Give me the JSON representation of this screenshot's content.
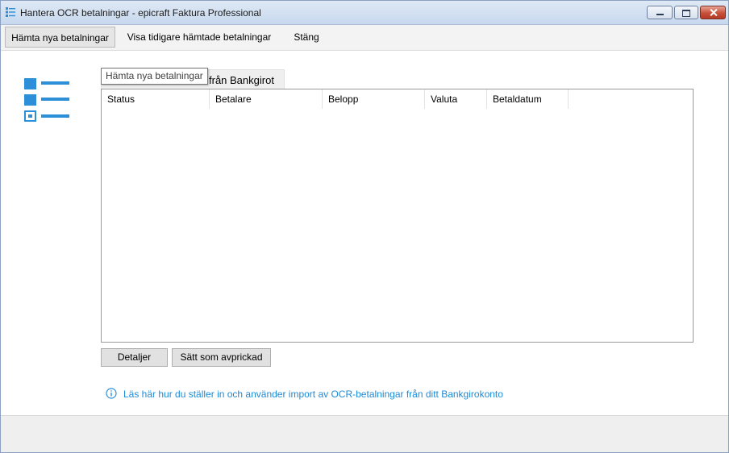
{
  "window": {
    "title": "Hantera OCR betalningar - epicraft Faktura Professional",
    "icon": "list-icon"
  },
  "toolbar": {
    "fetch_new_label": "Hämta nya betalningar",
    "show_previous_label": "Visa tidigare hämtade betalningar",
    "close_label": "Stäng"
  },
  "tooltip": {
    "text": "Hämta nya betalningar"
  },
  "tab": {
    "label": "från Bankgirot"
  },
  "grid": {
    "columns": [
      "Status",
      "Betalare",
      "Belopp",
      "Valuta",
      "Betaldatum"
    ],
    "rows": []
  },
  "actions": {
    "details_label": "Detaljer",
    "mark_label": "Sätt som avprickad"
  },
  "info": {
    "icon": "info-icon",
    "link_text": "Läs här hur du ställer in och använder import av OCR-betalningar från ditt Bankgirokonto"
  },
  "colors": {
    "accent": "#2e8fd9",
    "link": "#1c8bd8"
  }
}
